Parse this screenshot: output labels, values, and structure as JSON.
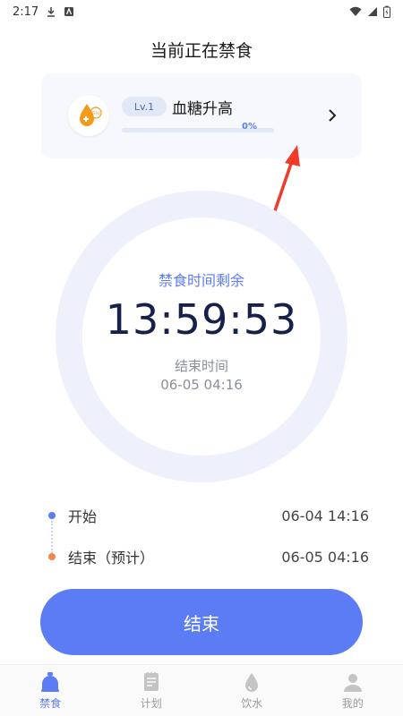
{
  "status_bar": {
    "time": "2:17"
  },
  "page": {
    "title": "当前正在禁食"
  },
  "level_card": {
    "level": "Lv.1",
    "name": "血糖升高",
    "progress_percent": 0,
    "progress_text": "0%",
    "avatar_icon": "glucose-drop-icon"
  },
  "timer": {
    "remaining_label": "禁食时间剩余",
    "remaining_time": "13:59:53",
    "end_label": "结束时间",
    "end_value": "06-05 04:16"
  },
  "timeline": {
    "start": {
      "label": "开始",
      "value": "06-04 14:16",
      "color": "#5b7cf5"
    },
    "end": {
      "label": "结束（预计）",
      "value": "06-05 04:16",
      "color": "#f5844a"
    }
  },
  "end_button": {
    "label": "结束"
  },
  "nav": {
    "items": [
      {
        "label": "禁食",
        "icon": "fasting-icon",
        "active": true
      },
      {
        "label": "计划",
        "icon": "plan-icon",
        "active": false
      },
      {
        "label": "饮水",
        "icon": "water-drop-icon",
        "active": false
      },
      {
        "label": "我的",
        "icon": "profile-icon",
        "active": false
      }
    ]
  },
  "colors": {
    "accent": "#5b7cf5",
    "ring": "#eef1fc",
    "nav_inactive": "#b5b5b5"
  }
}
